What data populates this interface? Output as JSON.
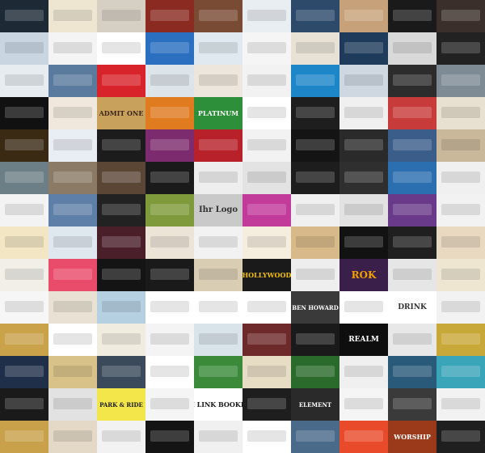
{
  "gallery": {
    "columns": 10,
    "rows": 14,
    "tiles": [
      {
        "r": 0,
        "c": 0,
        "bg": "#1d2a36",
        "fg": "#ffffff",
        "text": ""
      },
      {
        "r": 0,
        "c": 1,
        "bg": "#efe6d2",
        "fg": "#333333",
        "text": ""
      },
      {
        "r": 0,
        "c": 2,
        "bg": "#d6d0c4",
        "fg": "#333333",
        "text": ""
      },
      {
        "r": 0,
        "c": 3,
        "bg": "#8a2a20",
        "fg": "#ffffff",
        "text": ""
      },
      {
        "r": 0,
        "c": 4,
        "bg": "#7a4b34",
        "fg": "#ffffff",
        "text": ""
      },
      {
        "r": 0,
        "c": 5,
        "bg": "#e9eef2",
        "fg": "#333333",
        "text": ""
      },
      {
        "r": 0,
        "c": 6,
        "bg": "#2d4a6b",
        "fg": "#ffffff",
        "text": ""
      },
      {
        "r": 0,
        "c": 7,
        "bg": "#c7a179",
        "fg": "#ffffff",
        "text": ""
      },
      {
        "r": 0,
        "c": 8,
        "bg": "#1a1a1a",
        "fg": "#ffffff",
        "text": ""
      },
      {
        "r": 0,
        "c": 9,
        "bg": "#3a2f2a",
        "fg": "#f2c200",
        "text": ""
      },
      {
        "r": 1,
        "c": 0,
        "bg": "#c9d6e2",
        "fg": "#333333",
        "text": ""
      },
      {
        "r": 1,
        "c": 1,
        "bg": "#f4f4f4",
        "fg": "#333333",
        "text": ""
      },
      {
        "r": 1,
        "c": 2,
        "bg": "#ffffff",
        "fg": "#333333",
        "text": ""
      },
      {
        "r": 1,
        "c": 3,
        "bg": "#2a6fc0",
        "fg": "#ffffff",
        "text": ""
      },
      {
        "r": 1,
        "c": 4,
        "bg": "#dfe9ef",
        "fg": "#333333",
        "text": ""
      },
      {
        "r": 1,
        "c": 5,
        "bg": "#f5f5f5",
        "fg": "#333333",
        "text": ""
      },
      {
        "r": 1,
        "c": 6,
        "bg": "#e8e2d6",
        "fg": "#333333",
        "text": ""
      },
      {
        "r": 1,
        "c": 7,
        "bg": "#1f3b5c",
        "fg": "#ffffff",
        "text": ""
      },
      {
        "r": 1,
        "c": 8,
        "bg": "#d9d9d9",
        "fg": "#333333",
        "text": ""
      },
      {
        "r": 1,
        "c": 9,
        "bg": "#222222",
        "fg": "#ffffff",
        "text": ""
      },
      {
        "r": 2,
        "c": 0,
        "bg": "#e7ecf1",
        "fg": "#333333",
        "text": ""
      },
      {
        "r": 2,
        "c": 1,
        "bg": "#5a7a9e",
        "fg": "#ffffff",
        "text": ""
      },
      {
        "r": 2,
        "c": 2,
        "bg": "#d8232a",
        "fg": "#ffffff",
        "text": ""
      },
      {
        "r": 2,
        "c": 3,
        "bg": "#dde4ea",
        "fg": "#333333",
        "text": ""
      },
      {
        "r": 2,
        "c": 4,
        "bg": "#ece6dc",
        "fg": "#333333",
        "text": ""
      },
      {
        "r": 2,
        "c": 5,
        "bg": "#f2f2f2",
        "fg": "#333333",
        "text": ""
      },
      {
        "r": 2,
        "c": 6,
        "bg": "#1c86c8",
        "fg": "#ffffff",
        "text": ""
      },
      {
        "r": 2,
        "c": 7,
        "bg": "#cfd8e1",
        "fg": "#333333",
        "text": ""
      },
      {
        "r": 2,
        "c": 8,
        "bg": "#2c2c2c",
        "fg": "#ffffff",
        "text": ""
      },
      {
        "r": 2,
        "c": 9,
        "bg": "#7e8a94",
        "fg": "#ffffff",
        "text": ""
      },
      {
        "r": 3,
        "c": 0,
        "bg": "#111111",
        "fg": "#f2c200",
        "text": ""
      },
      {
        "r": 3,
        "c": 1,
        "bg": "#f0e8dc",
        "fg": "#333333",
        "text": ""
      },
      {
        "r": 3,
        "c": 2,
        "bg": "#c8a25c",
        "fg": "#3a2414",
        "text": "ADMIT ONE",
        "size": 8
      },
      {
        "r": 3,
        "c": 3,
        "bg": "#e07b20",
        "fg": "#ffffff",
        "text": ""
      },
      {
        "r": 3,
        "c": 4,
        "bg": "#2e8f3a",
        "fg": "#ffffff",
        "text": "PLATINUM",
        "size": 8
      },
      {
        "r": 3,
        "c": 5,
        "bg": "#ffffff",
        "fg": "#333333",
        "text": ""
      },
      {
        "r": 3,
        "c": 6,
        "bg": "#1e1e1e",
        "fg": "#ffffff",
        "text": ""
      },
      {
        "r": 3,
        "c": 7,
        "bg": "#f0f0f0",
        "fg": "#333333",
        "text": ""
      },
      {
        "r": 3,
        "c": 8,
        "bg": "#c83b3b",
        "fg": "#ffffff",
        "text": ""
      },
      {
        "r": 3,
        "c": 9,
        "bg": "#e8e0d0",
        "fg": "#333333",
        "text": ""
      },
      {
        "r": 4,
        "c": 0,
        "bg": "#3a2a14",
        "fg": "#f5d48a",
        "text": ""
      },
      {
        "r": 4,
        "c": 1,
        "bg": "#e9eef4",
        "fg": "#333333",
        "text": ""
      },
      {
        "r": 4,
        "c": 2,
        "bg": "#1c1c1c",
        "fg": "#ffffff",
        "text": ""
      },
      {
        "r": 4,
        "c": 3,
        "bg": "#7c2b6e",
        "fg": "#ffffff",
        "text": ""
      },
      {
        "r": 4,
        "c": 4,
        "bg": "#b8202a",
        "fg": "#ffffff",
        "text": ""
      },
      {
        "r": 4,
        "c": 5,
        "bg": "#f2f2f2",
        "fg": "#333333",
        "text": ""
      },
      {
        "r": 4,
        "c": 6,
        "bg": "#141414",
        "fg": "#ffffff",
        "text": ""
      },
      {
        "r": 4,
        "c": 7,
        "bg": "#2a2a2a",
        "fg": "#ffffff",
        "text": ""
      },
      {
        "r": 4,
        "c": 8,
        "bg": "#3b5d8a",
        "fg": "#ffffff",
        "text": ""
      },
      {
        "r": 4,
        "c": 9,
        "bg": "#c9b89a",
        "fg": "#333333",
        "text": ""
      },
      {
        "r": 5,
        "c": 0,
        "bg": "#6d7f86",
        "fg": "#ffffff",
        "text": ""
      },
      {
        "r": 5,
        "c": 1,
        "bg": "#8a7a66",
        "fg": "#ffffff",
        "text": ""
      },
      {
        "r": 5,
        "c": 2,
        "bg": "#5b4636",
        "fg": "#ffffff",
        "text": ""
      },
      {
        "r": 5,
        "c": 3,
        "bg": "#1a1a1a",
        "fg": "#ffffff",
        "text": ""
      },
      {
        "r": 5,
        "c": 4,
        "bg": "#eeeeee",
        "fg": "#333333",
        "text": ""
      },
      {
        "r": 5,
        "c": 5,
        "bg": "#e3e3e3",
        "fg": "#333333",
        "text": ""
      },
      {
        "r": 5,
        "c": 6,
        "bg": "#1d1d1d",
        "fg": "#ffffff",
        "text": ""
      },
      {
        "r": 5,
        "c": 7,
        "bg": "#2f2f2f",
        "fg": "#ffffff",
        "text": ""
      },
      {
        "r": 5,
        "c": 8,
        "bg": "#2b6fb0",
        "fg": "#ffffff",
        "text": ""
      },
      {
        "r": 5,
        "c": 9,
        "bg": "#f0f0f0",
        "fg": "#333333",
        "text": ""
      },
      {
        "r": 6,
        "c": 0,
        "bg": "#f3f3f3",
        "fg": "#333333",
        "text": ""
      },
      {
        "r": 6,
        "c": 1,
        "bg": "#5e7fa8",
        "fg": "#ffffff",
        "text": ""
      },
      {
        "r": 6,
        "c": 2,
        "bg": "#222222",
        "fg": "#ffffff",
        "text": ""
      },
      {
        "r": 6,
        "c": 3,
        "bg": "#7e9a3a",
        "fg": "#ffffff",
        "text": ""
      },
      {
        "r": 6,
        "c": 4,
        "bg": "#c9c9c9",
        "fg": "#333333",
        "text": "Ihr Logo",
        "size": 10
      },
      {
        "r": 6,
        "c": 5,
        "bg": "#c23a9a",
        "fg": "#ffffff",
        "text": ""
      },
      {
        "r": 6,
        "c": 6,
        "bg": "#f0f0f0",
        "fg": "#333333",
        "text": ""
      },
      {
        "r": 6,
        "c": 7,
        "bg": "#e2e2e2",
        "fg": "#333333",
        "text": ""
      },
      {
        "r": 6,
        "c": 8,
        "bg": "#6a3a8a",
        "fg": "#ffffff",
        "text": ""
      },
      {
        "r": 6,
        "c": 9,
        "bg": "#f2f2f2",
        "fg": "#333333",
        "text": ""
      },
      {
        "r": 7,
        "c": 0,
        "bg": "#f2e6c4",
        "fg": "#333333",
        "text": ""
      },
      {
        "r": 7,
        "c": 1,
        "bg": "#dfe7ef",
        "fg": "#333333",
        "text": ""
      },
      {
        "r": 7,
        "c": 2,
        "bg": "#4a1f2a",
        "fg": "#ffffff",
        "text": ""
      },
      {
        "r": 7,
        "c": 3,
        "bg": "#ece4d6",
        "fg": "#333333",
        "text": ""
      },
      {
        "r": 7,
        "c": 4,
        "bg": "#f2f2f2",
        "fg": "#333333",
        "text": ""
      },
      {
        "r": 7,
        "c": 5,
        "bg": "#f5eede",
        "fg": "#333333",
        "text": ""
      },
      {
        "r": 7,
        "c": 6,
        "bg": "#d7b98a",
        "fg": "#333333",
        "text": ""
      },
      {
        "r": 7,
        "c": 7,
        "bg": "#121212",
        "fg": "#ffffff",
        "text": ""
      },
      {
        "r": 7,
        "c": 8,
        "bg": "#1f1f1f",
        "fg": "#ffffff",
        "text": ""
      },
      {
        "r": 7,
        "c": 9,
        "bg": "#e8d9c0",
        "fg": "#333333",
        "text": ""
      },
      {
        "r": 8,
        "c": 0,
        "bg": "#f1efe8",
        "fg": "#333333",
        "text": ""
      },
      {
        "r": 8,
        "c": 1,
        "bg": "#e94b6a",
        "fg": "#ffffff",
        "text": ""
      },
      {
        "r": 8,
        "c": 2,
        "bg": "#141414",
        "fg": "#ffffff",
        "text": ""
      },
      {
        "r": 8,
        "c": 3,
        "bg": "#1a1a1a",
        "fg": "#ffffff",
        "text": ""
      },
      {
        "r": 8,
        "c": 4,
        "bg": "#d9cdb4",
        "fg": "#333333",
        "text": ""
      },
      {
        "r": 8,
        "c": 5,
        "bg": "#1a1a1a",
        "fg": "#f2c200",
        "text": "HOLLYWOOD",
        "size": 8
      },
      {
        "r": 8,
        "c": 6,
        "bg": "#eeeeee",
        "fg": "#333333",
        "text": ""
      },
      {
        "r": 8,
        "c": 7,
        "bg": "#3a1f4a",
        "fg": "#f2a000",
        "text": "ROK",
        "size": 12
      },
      {
        "r": 8,
        "c": 8,
        "bg": "#e6e6e6",
        "fg": "#333333",
        "text": ""
      },
      {
        "r": 8,
        "c": 9,
        "bg": "#efe6d2",
        "fg": "#333333",
        "text": ""
      },
      {
        "r": 9,
        "c": 0,
        "bg": "#f6f6f6",
        "fg": "#333333",
        "text": ""
      },
      {
        "r": 9,
        "c": 1,
        "bg": "#e9e2d4",
        "fg": "#333333",
        "text": ""
      },
      {
        "r": 9,
        "c": 2,
        "bg": "#b5d0e0",
        "fg": "#333333",
        "text": ""
      },
      {
        "r": 9,
        "c": 3,
        "bg": "#ffffff",
        "fg": "#333333",
        "text": ""
      },
      {
        "r": 9,
        "c": 4,
        "bg": "#ffffff",
        "fg": "#333333",
        "text": ""
      },
      {
        "r": 9,
        "c": 5,
        "bg": "#ffffff",
        "fg": "#333333",
        "text": ""
      },
      {
        "r": 9,
        "c": 6,
        "bg": "#3a3a3a",
        "fg": "#ffffff",
        "text": "BEN HOWARD",
        "size": 7
      },
      {
        "r": 9,
        "c": 7,
        "bg": "#ffffff",
        "fg": "#333333",
        "text": ""
      },
      {
        "r": 9,
        "c": 8,
        "bg": "#ffffff",
        "fg": "#333333",
        "text": "DRINK",
        "size": 9
      },
      {
        "r": 9,
        "c": 9,
        "bg": "#f2f2f2",
        "fg": "#333333",
        "text": ""
      },
      {
        "r": 10,
        "c": 0,
        "bg": "#c9a24a",
        "fg": "#ffffff",
        "text": ""
      },
      {
        "r": 10,
        "c": 1,
        "bg": "#ffffff",
        "fg": "#333333",
        "text": ""
      },
      {
        "r": 10,
        "c": 2,
        "bg": "#f1ece0",
        "fg": "#333333",
        "text": ""
      },
      {
        "r": 10,
        "c": 3,
        "bg": "#f4f4f4",
        "fg": "#333333",
        "text": ""
      },
      {
        "r": 10,
        "c": 4,
        "bg": "#d8e4ea",
        "fg": "#333333",
        "text": ""
      },
      {
        "r": 10,
        "c": 5,
        "bg": "#6e2a2a",
        "fg": "#ffffff",
        "text": ""
      },
      {
        "r": 10,
        "c": 6,
        "bg": "#1a1a1a",
        "fg": "#ffffff",
        "text": ""
      },
      {
        "r": 10,
        "c": 7,
        "bg": "#0e0e0e",
        "fg": "#ffffff",
        "text": "REALM",
        "size": 9
      },
      {
        "r": 10,
        "c": 8,
        "bg": "#e8e8e8",
        "fg": "#333333",
        "text": ""
      },
      {
        "r": 10,
        "c": 9,
        "bg": "#c9a83a",
        "fg": "#ffffff",
        "text": ""
      },
      {
        "r": 11,
        "c": 0,
        "bg": "#1f2f4a",
        "fg": "#ffffff",
        "text": ""
      },
      {
        "r": 11,
        "c": 1,
        "bg": "#d9c28a",
        "fg": "#333333",
        "text": ""
      },
      {
        "r": 11,
        "c": 2,
        "bg": "#3a4a5a",
        "fg": "#ffffff",
        "text": ""
      },
      {
        "r": 11,
        "c": 3,
        "bg": "#ffffff",
        "fg": "#333333",
        "text": ""
      },
      {
        "r": 11,
        "c": 4,
        "bg": "#3a8a3a",
        "fg": "#ffffff",
        "text": ""
      },
      {
        "r": 11,
        "c": 5,
        "bg": "#e7dcc4",
        "fg": "#333333",
        "text": ""
      },
      {
        "r": 11,
        "c": 6,
        "bg": "#2a6a2a",
        "fg": "#ffffff",
        "text": ""
      },
      {
        "r": 11,
        "c": 7,
        "bg": "#f0f0f0",
        "fg": "#333333",
        "text": ""
      },
      {
        "r": 11,
        "c": 8,
        "bg": "#2a5a7a",
        "fg": "#ffffff",
        "text": ""
      },
      {
        "r": 11,
        "c": 9,
        "bg": "#3aa4b8",
        "fg": "#ffffff",
        "text": ""
      },
      {
        "r": 12,
        "c": 0,
        "bg": "#1a1a1a",
        "fg": "#ffffff",
        "text": ""
      },
      {
        "r": 12,
        "c": 1,
        "bg": "#e2e2e2",
        "fg": "#333333",
        "text": ""
      },
      {
        "r": 12,
        "c": 2,
        "bg": "#f2e64a",
        "fg": "#1a1a1a",
        "text": "PARK & RIDE",
        "size": 7
      },
      {
        "r": 12,
        "c": 3,
        "bg": "#f5f5f5",
        "fg": "#333333",
        "text": ""
      },
      {
        "r": 12,
        "c": 4,
        "bg": "#ffffff",
        "fg": "#1a1a1a",
        "text": "TI LINK BOOKIN",
        "size": 8
      },
      {
        "r": 12,
        "c": 5,
        "bg": "#1e1e1e",
        "fg": "#ffffff",
        "text": ""
      },
      {
        "r": 12,
        "c": 6,
        "bg": "#2a2a2a",
        "fg": "#ffffff",
        "text": "ELEMENT",
        "size": 7
      },
      {
        "r": 12,
        "c": 7,
        "bg": "#f5f5f5",
        "fg": "#333333",
        "text": ""
      },
      {
        "r": 12,
        "c": 8,
        "bg": "#3a3a3a",
        "fg": "#ffffff",
        "text": ""
      },
      {
        "r": 12,
        "c": 9,
        "bg": "#f2f2f2",
        "fg": "#333333",
        "text": ""
      },
      {
        "r": 13,
        "c": 0,
        "bg": "#c8a14a",
        "fg": "#ffffff",
        "text": ""
      },
      {
        "r": 13,
        "c": 1,
        "bg": "#e3d9c6",
        "fg": "#333333",
        "text": ""
      },
      {
        "r": 13,
        "c": 2,
        "bg": "#f2f2f2",
        "fg": "#333333",
        "text": ""
      },
      {
        "r": 13,
        "c": 3,
        "bg": "#141414",
        "fg": "#ffffff",
        "text": ""
      },
      {
        "r": 13,
        "c": 4,
        "bg": "#f0f0f0",
        "fg": "#333333",
        "text": ""
      },
      {
        "r": 13,
        "c": 5,
        "bg": "#ffffff",
        "fg": "#333333",
        "text": ""
      },
      {
        "r": 13,
        "c": 6,
        "bg": "#4a6a8a",
        "fg": "#ffffff",
        "text": ""
      },
      {
        "r": 13,
        "c": 7,
        "bg": "#e94b2a",
        "fg": "#ffffff",
        "text": ""
      },
      {
        "r": 13,
        "c": 8,
        "bg": "#9a3a1a",
        "fg": "#ffffff",
        "text": "WORSHIP",
        "size": 8
      },
      {
        "r": 13,
        "c": 9,
        "bg": "#1f1f1f",
        "fg": "#ffffff",
        "text": ""
      }
    ]
  }
}
